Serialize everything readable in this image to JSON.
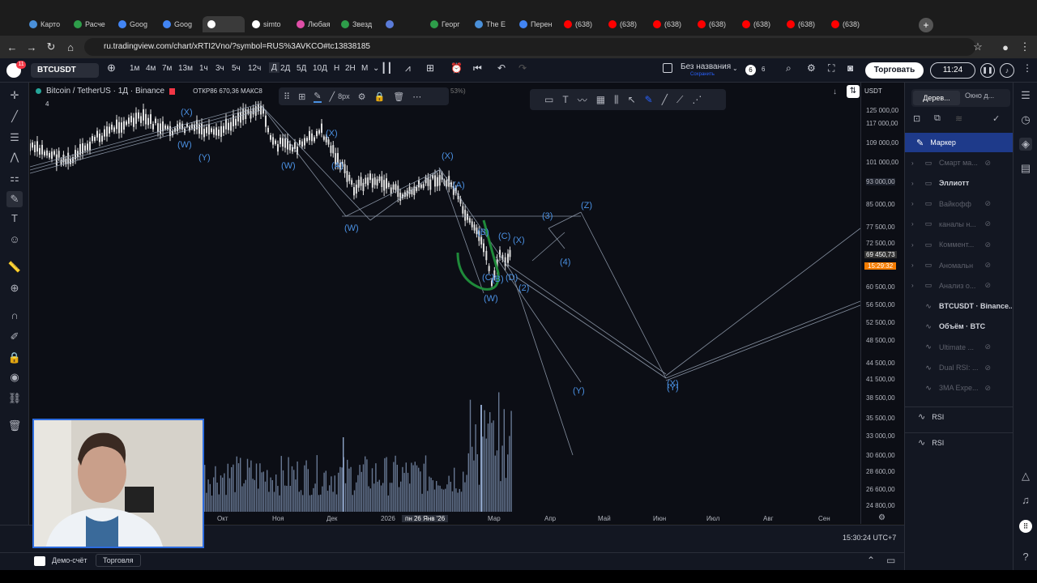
{
  "browser": {
    "tabs": [
      {
        "label": "Карто",
        "color": "#4a90d9"
      },
      {
        "label": "Расче",
        "color": "#2e9e4a"
      },
      {
        "label": "Goog",
        "color": "#4285f4"
      },
      {
        "label": "Goog",
        "color": "#4285f4"
      },
      {
        "label": "",
        "color": "#ffffff"
      },
      {
        "label": "simto",
        "color": "#ffffff"
      },
      {
        "label": "Любая",
        "color": "#e04fa8"
      },
      {
        "label": "Звезд",
        "color": "#2e9e4a"
      },
      {
        "label": "",
        "color": "#5a7bd8"
      },
      {
        "label": "Георг",
        "color": "#2e9e4a"
      },
      {
        "label": "The E",
        "color": "#4a90d9"
      },
      {
        "label": "Перен",
        "color": "#4285f4"
      },
      {
        "label": "(638)",
        "color": "#ff0000"
      },
      {
        "label": "(638)",
        "color": "#ff0000"
      },
      {
        "label": "(638)",
        "color": "#ff0000"
      },
      {
        "label": "(638)",
        "color": "#ff0000"
      },
      {
        "label": "(638)",
        "color": "#ff0000"
      },
      {
        "label": "(638)",
        "color": "#ff0000"
      },
      {
        "label": "(638)",
        "color": "#ff0000"
      }
    ],
    "url": "ru.tradingview.com/chart/xRTI2Vno/?symbol=RUS%3AVKCO#tc13838185"
  },
  "toolbar": {
    "symbol": "BTCUSDT",
    "badge": "11",
    "intervals": [
      "1м",
      "4м",
      "7м",
      "13м",
      "1ч",
      "3ч",
      "5ч",
      "12ч",
      "Д",
      "2Д",
      "5Д",
      "10Д",
      "Н",
      "2Н",
      "М"
    ],
    "active_interval": "Д",
    "layout_name": "Без названия",
    "layout_status": "Сохранить",
    "counter1": "6",
    "counter2": "6",
    "trade_label": "Торговать",
    "timer": "11:24"
  },
  "legend": {
    "title": "Bitcoin / TetherUS · 1Д · Binance",
    "ohlc": "ОТКР86 670,36 МАКС8",
    "pct": "53%)",
    "sub": "4",
    "brush_size": "8px"
  },
  "price_scale": {
    "currency": "USDT",
    "labels": [
      "125 000,00",
      "117 000,00",
      "109 000,00",
      "101 000,00",
      "93 000,00",
      "85 000,00",
      "77 500,00",
      "72 500,00",
      "69 450,73",
      "15:29:32",
      "60 500,00",
      "56 500,00",
      "52 500,00",
      "48 500,00",
      "44 500,00",
      "41 500,00",
      "38 500,00",
      "35 500,00",
      "33 000,00",
      "30 600,00",
      "28 600,00",
      "26 600,00",
      "24 800,00"
    ]
  },
  "time_scale": {
    "labels": [
      "Окт",
      "Ноя",
      "Дек",
      "2026",
      "пн 26 Янв '26",
      "Мар",
      "Апр",
      "Май",
      "Июн",
      "Июл",
      "Авг",
      "Сен"
    ],
    "clock": "15:30:24 UTC+7"
  },
  "wave_labels": [
    "(X)",
    "(W)",
    "(Y)",
    "(W)",
    "(X)",
    "(W)",
    "(A)",
    "(X)",
    "(W)",
    "(A)",
    "(B)",
    "(C)",
    "(X)",
    "(C)",
    "(B)",
    "(D)",
    "(W)",
    "(3)",
    "(4)",
    "(2)",
    "(Y)",
    "(Z)",
    "(Y)",
    "(X)"
  ],
  "footer": {
    "demo": "Демо-счёт",
    "trading": "Торговля"
  },
  "right_panel": {
    "tabs": [
      "Дерев...",
      "Окно д..."
    ],
    "selected": "Маркер",
    "items": [
      {
        "label": "Смарт ма...",
        "dim": true,
        "folder": true
      },
      {
        "label": "Эллиотт",
        "dim": false,
        "folder": true
      },
      {
        "label": "Вайкофф",
        "dim": true,
        "folder": true
      },
      {
        "label": "каналы н...",
        "dim": true,
        "folder": true
      },
      {
        "label": "Коммент...",
        "dim": true,
        "folder": true
      },
      {
        "label": "Аномальн",
        "dim": true,
        "folder": true
      },
      {
        "label": "Анализ о...",
        "dim": true,
        "folder": true
      },
      {
        "label": "BTCUSDT · Binance...",
        "dim": false,
        "folder": false
      },
      {
        "label": "Объём · BTC",
        "dim": false,
        "folder": false
      },
      {
        "label": "Ultimate ...",
        "dim": true,
        "folder": false
      },
      {
        "label": "Dual RSI: ...",
        "dim": true,
        "folder": false
      },
      {
        "label": "3MA Expe...",
        "dim": true,
        "folder": false
      }
    ],
    "rsi1": "RSI",
    "rsi2": "RSI"
  },
  "colors": {
    "accent": "#2962ff",
    "candle": "#e0e0e0",
    "wave": "#4a90e2",
    "price_tag": "#f57c00"
  }
}
